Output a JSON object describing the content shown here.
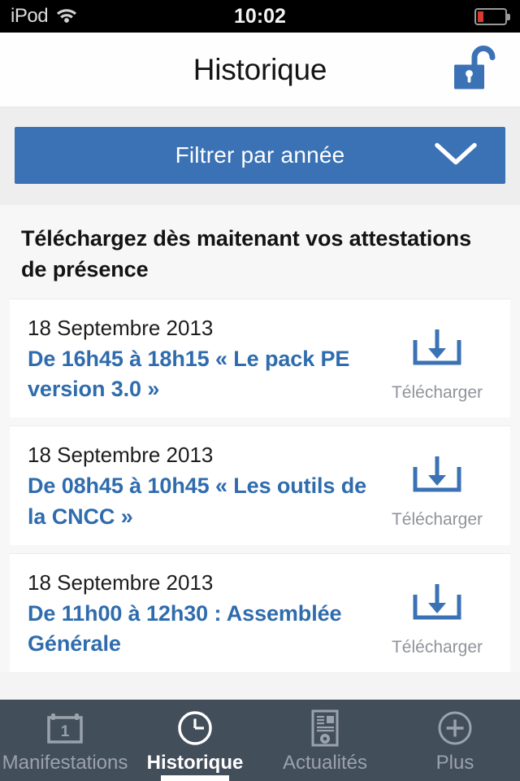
{
  "statusbar": {
    "carrier": "iPod",
    "wifi_icon": "wifi-icon",
    "time": "10:02",
    "battery_icon": "battery-icon",
    "battery_level_pct": 12,
    "battery_color": "#d93b30"
  },
  "navbar": {
    "title": "Historique",
    "lock_icon": "unlocked-padlock-icon",
    "lock_color": "#3a72b5"
  },
  "filter": {
    "label": "Filtrer par année",
    "chevron_icon": "chevron-down-icon",
    "background_color": "#3a72b5",
    "text_color": "#ffffff"
  },
  "content": {
    "heading": "Téléchargez dès maitenant vos attestations de présence",
    "items": [
      {
        "date": "18 Septembre 2013",
        "title": "De 16h45 à 18h15 « Le pack PE version 3.0 »",
        "action_label": "Télécharger",
        "action_icon": "download-icon"
      },
      {
        "date": "18 Septembre 2013",
        "title": "De 08h45 à 10h45 « Les outils de la CNCC »",
        "action_label": "Télécharger",
        "action_icon": "download-icon"
      },
      {
        "date": "18 Septembre 2013",
        "title": "De 11h00 à 12h30 : Assemblée Générale",
        "action_label": "Télécharger",
        "action_icon": "download-icon"
      }
    ],
    "link_color": "#2f6cad"
  },
  "tabbar": {
    "background_color": "#434e5b",
    "active_color": "#ffffff",
    "inactive_color": "#9aa2ac",
    "tabs": [
      {
        "label": "Manifestations",
        "icon": "calendar-icon",
        "active": false
      },
      {
        "label": "Historique",
        "icon": "clock-icon",
        "active": true
      },
      {
        "label": "Actualités",
        "icon": "news-settings-icon",
        "active": false
      },
      {
        "label": "Plus",
        "icon": "plus-circle-icon",
        "active": false
      }
    ]
  }
}
